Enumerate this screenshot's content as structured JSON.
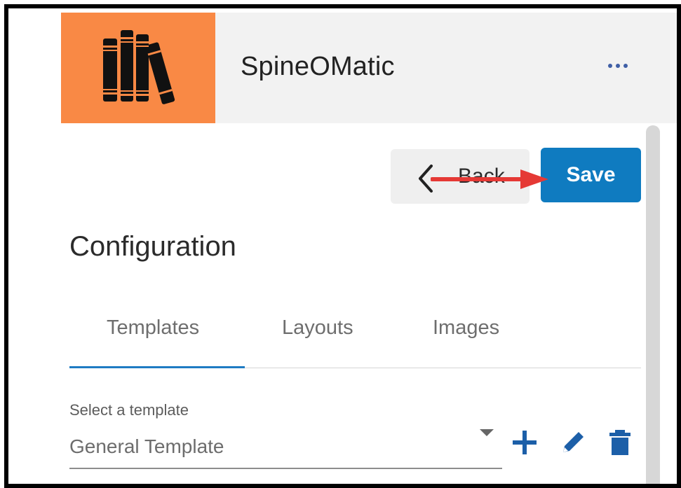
{
  "app": {
    "title": "SpineOMatic",
    "logo_icon": "books-icon",
    "header_bg": "#f2f2f2",
    "logo_bg": "#f98945",
    "more_icon": "more-horizontal-icon"
  },
  "toolbar": {
    "back_label": "Back",
    "back_icon": "chevron-left-icon",
    "save_label": "Save",
    "save_color": "#0f7bc0",
    "annotation_arrow_color": "#e53935"
  },
  "page": {
    "title": "Configuration"
  },
  "tabs": [
    {
      "label": "Templates",
      "active": true
    },
    {
      "label": "Layouts",
      "active": false
    },
    {
      "label": "Images",
      "active": false
    }
  ],
  "template_select": {
    "label": "Select a template",
    "value": "General Template"
  },
  "template_actions": {
    "add_icon": "plus-icon",
    "edit_icon": "pencil-icon",
    "delete_icon": "trash-icon",
    "icon_color": "#1c5fa8"
  }
}
